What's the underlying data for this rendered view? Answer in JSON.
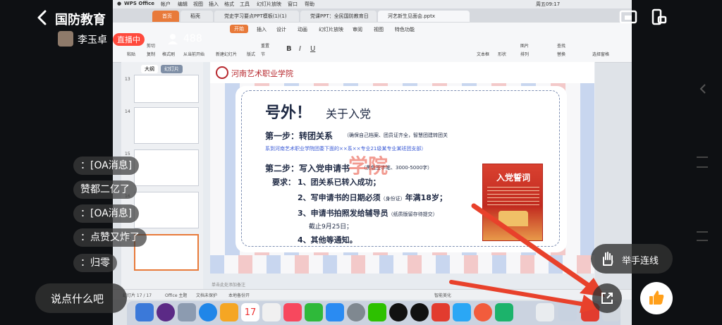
{
  "header": {
    "title": "国防教育",
    "back_icon": "chevron-left-icon"
  },
  "streamer": {
    "name": "李玉卓",
    "live_badge": "直播中",
    "viewer_count": "488"
  },
  "screen": {
    "mac_menu": [
      "WPS Office",
      "帐户",
      "编辑",
      "视图",
      "插入",
      "格式",
      "工具",
      "幻灯片放映",
      "窗口",
      "帮助"
    ],
    "mac_time": "周五09:17",
    "tabs": [
      "首页",
      "稻壳",
      "党史学习要点PPT模板(1)(1)",
      "党课PPT：全民国防教育日",
      "党课PPT？…全民国防教育日",
      "河艺新生见面会.pptx"
    ],
    "menu": [
      "开始",
      "插入",
      "设计",
      "动画",
      "幻灯片放映",
      "审阅",
      "视图",
      "特色功能"
    ],
    "ribbon": [
      "粘贴",
      "剪切",
      "复制",
      "格式刷",
      "从当前开始",
      "新建幻灯片",
      "版式",
      "节",
      "重置",
      "文本框",
      "形状",
      "图片",
      "排列",
      "查找",
      "替换",
      "选择窗格"
    ],
    "panel_tabs": [
      "大纲",
      "幻灯片"
    ],
    "slide_numbers": [
      "13",
      "14",
      "15",
      "16",
      "17"
    ],
    "status": {
      "slide": "幻灯片 17 / 17",
      "theme": "Office 主题",
      "protect": "文档未保护",
      "backup": "本地备份开",
      "beautify": "智能美化",
      "note": "单击此处添加备注"
    }
  },
  "slide": {
    "school": "河南艺术职业学院",
    "title_big": "号外！",
    "title_small": "关于入党",
    "step1_label": "第一步：转团关系",
    "step1_note": "（确保自己档案、团员证齐全，智慧团建转团关",
    "step1_blue": "系到河南艺术职业学院团委下面的××系××专业21级某专业某班团支部）",
    "step2_label": "第二步：写入党申请书",
    "step2_note": "（黑色签字笔、3000-5000字）",
    "req_label": "要求：",
    "req1": "1、团关系已转入成功；",
    "req2": "2、写申请书的日期必须",
    "req2_small": "（身份证）",
    "req2_end": "年满18岁；",
    "req3": "3、申请书拍照发给辅导员",
    "req3_small": "（纸质版留存待提交）",
    "req3_sub": "截止9月25日；",
    "req4": "4、其他等通知。",
    "poster_title": "入党誓词",
    "watermark": "学院"
  },
  "comments": [
    {
      "name": "",
      "text": "：[OA消息]"
    },
    {
      "name": "",
      "text": "赞都二亿了"
    },
    {
      "name": "",
      "text": "：[OA消息]"
    },
    {
      "name": "",
      "text": "：点赞又炸了"
    },
    {
      "name": "",
      "text": "：归零"
    }
  ],
  "bottom": {
    "input_placeholder": "说点什么吧",
    "raise_hand": "举手连线"
  },
  "colors": {
    "accent": "#e87a3a",
    "live": "#ff4a3d",
    "like": "#ff9f1a",
    "arrow": "#e8412b"
  }
}
